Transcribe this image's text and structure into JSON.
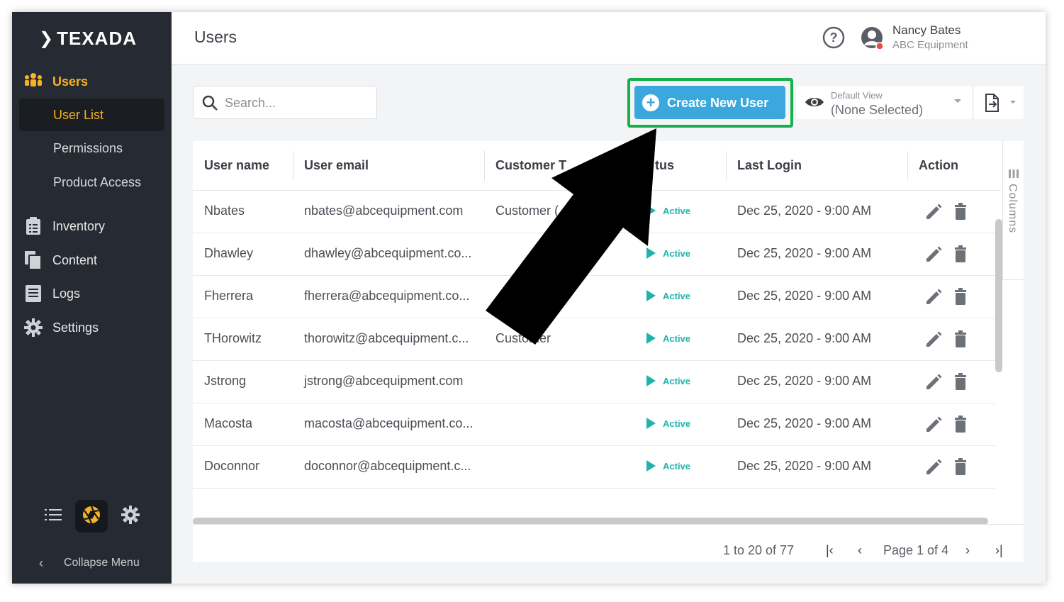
{
  "brand": {
    "name": "TEXADA"
  },
  "sidebar": {
    "section_users": "Users",
    "items": [
      {
        "label": "User List"
      },
      {
        "label": "Permissions"
      },
      {
        "label": "Product Access"
      }
    ],
    "nav": [
      {
        "label": "Inventory",
        "icon": "clipboard-icon"
      },
      {
        "label": "Content",
        "icon": "documents-icon"
      },
      {
        "label": "Logs",
        "icon": "logs-icon"
      },
      {
        "label": "Settings",
        "icon": "gear-icon"
      }
    ],
    "collapse_label": "Collapse Menu"
  },
  "header": {
    "title": "Users",
    "user_name": "Nancy Bates",
    "user_company": "ABC Equipment"
  },
  "toolbar": {
    "search_placeholder": "Search...",
    "create_label": "Create New User",
    "view_label": "Default View",
    "view_value": "(None Selected)"
  },
  "table": {
    "columns": [
      "User name",
      "User email",
      "Customer T",
      "tus",
      "Last Login",
      "Action"
    ],
    "rows": [
      {
        "username": "Nbates",
        "email": "nbates@abcequipment.com",
        "customer": "Customer (",
        "status": "Active",
        "last_login": "Dec 25, 2020 - 9:00 AM"
      },
      {
        "username": "Dhawley",
        "email": "dhawley@abcequipment.co...",
        "customer": "",
        "status": "Active",
        "last_login": "Dec 25, 2020 - 9:00 AM"
      },
      {
        "username": "Fherrera",
        "email": "fherrera@abcequipment.co...",
        "customer": "",
        "status": "Active",
        "last_login": "Dec 25, 2020 - 9:00 AM"
      },
      {
        "username": "THorowitz",
        "email": "thorowitz@abcequipment.c...",
        "customer": "Customer",
        "status": "Active",
        "last_login": "Dec 25, 2020 - 9:00 AM"
      },
      {
        "username": "Jstrong",
        "email": "jstrong@abcequipment.com",
        "customer": "",
        "status": "Active",
        "last_login": "Dec 25, 2020 - 9:00 AM"
      },
      {
        "username": "Macosta",
        "email": "macosta@abcequipment.co...",
        "customer": "",
        "status": "Active",
        "last_login": "Dec 25, 2020 - 9:00 AM"
      },
      {
        "username": "Doconnor",
        "email": "doconnor@abcequipment.c...",
        "customer": "",
        "status": "Active",
        "last_login": "Dec 25, 2020 - 9:00 AM"
      }
    ],
    "columns_tab": "Columns"
  },
  "pager": {
    "info": "1 to 20 of 77",
    "page": "Page 1 of 4"
  },
  "colors": {
    "sidebar_bg": "#262b33",
    "accent_yellow": "#f5b324",
    "primary_blue": "#3aa7dd",
    "highlight_green": "#15b04b",
    "status_teal": "#1fb3ad"
  }
}
